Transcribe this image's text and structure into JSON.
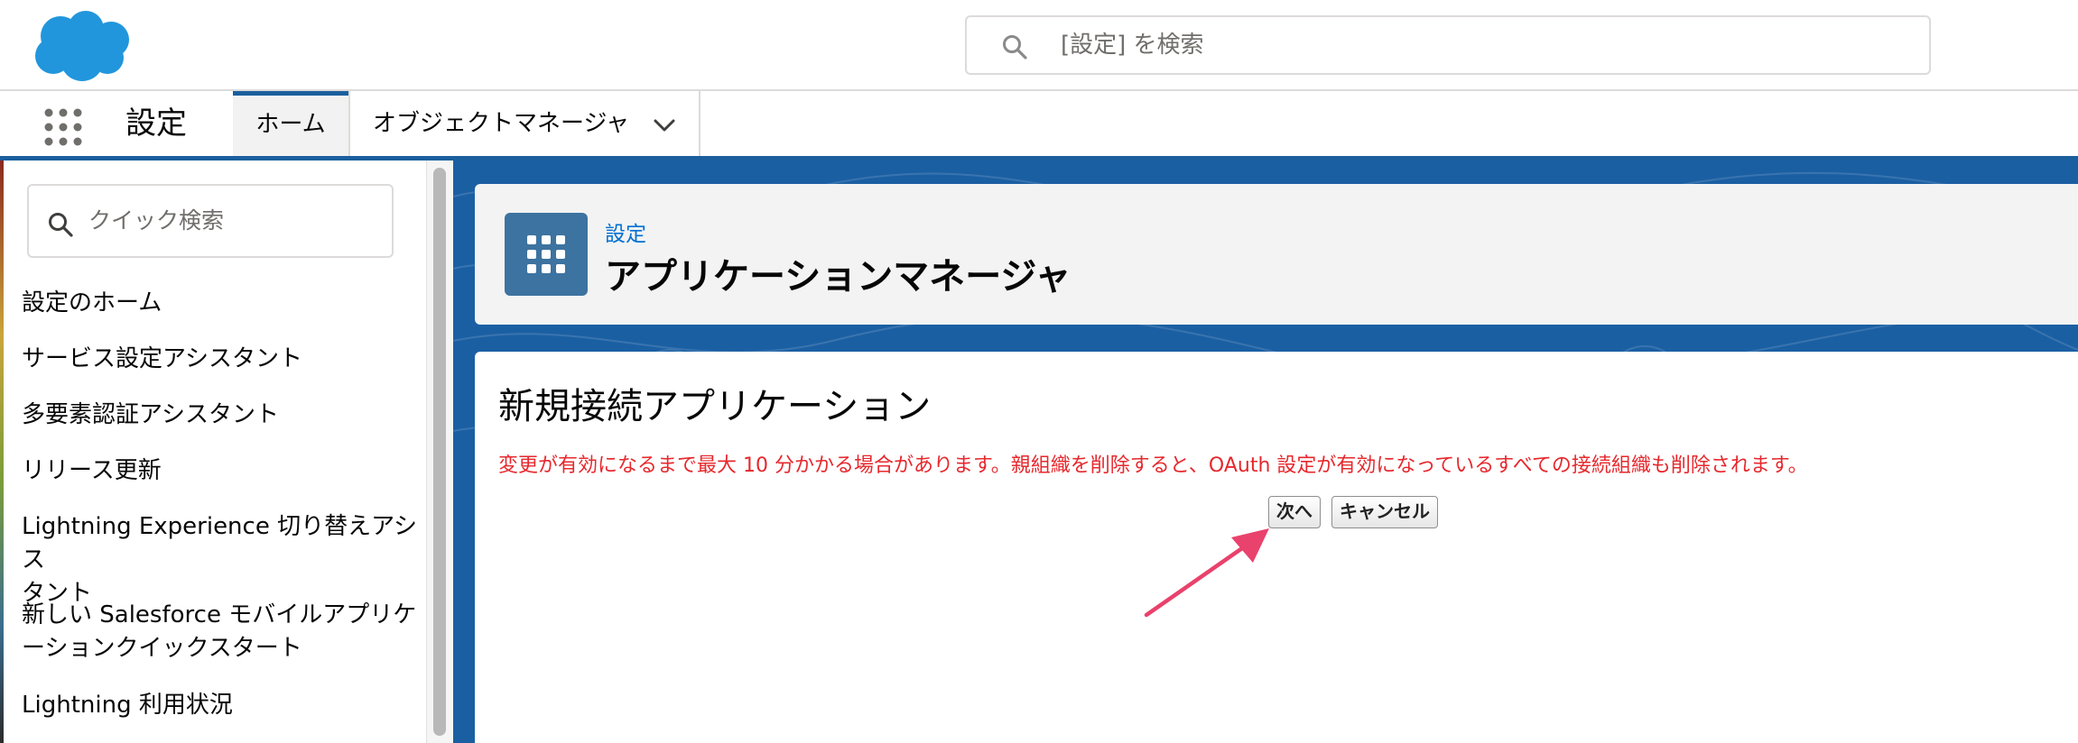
{
  "header": {
    "search_placeholder": "[設定] を検索"
  },
  "context_bar": {
    "app_name": "設定",
    "tabs": [
      {
        "label": "ホーム",
        "active": true
      },
      {
        "label": "オブジェクトマネージャ",
        "active": false
      }
    ]
  },
  "sidebar": {
    "quick_find_placeholder": "クイック検索",
    "items": [
      {
        "label": "設定のホーム"
      },
      {
        "label": "サービス設定アシスタント"
      },
      {
        "label": "多要素認証アシスタント"
      },
      {
        "label": "リリース更新"
      },
      {
        "label_line1": "Lightning Experience 切り替えアシス",
        "label_line2": "タント"
      },
      {
        "label_line1": "新しい Salesforce モバイルアプリケ",
        "label_line2": "ーションクイックスタート"
      },
      {
        "label": "Lightning 利用状況"
      }
    ]
  },
  "page_header": {
    "breadcrumb": "設定",
    "title": "アプリケーションマネージャ"
  },
  "content": {
    "section_title": "新規接続アプリケーション",
    "warning": "変更が有効になるまで最大 10 分かかる場合があります。親組織を削除すると、OAuth 設定が有効になっているすべての接続組織も削除されます。",
    "next_button": "次へ",
    "cancel_button": "キャンセル"
  },
  "colors": {
    "brand_blue": "#1b5f9e",
    "link_blue": "#0070d2",
    "warning_red": "#e6282d",
    "annotation_arrow": "#e9426c",
    "logo_blue": "#1798c1"
  }
}
